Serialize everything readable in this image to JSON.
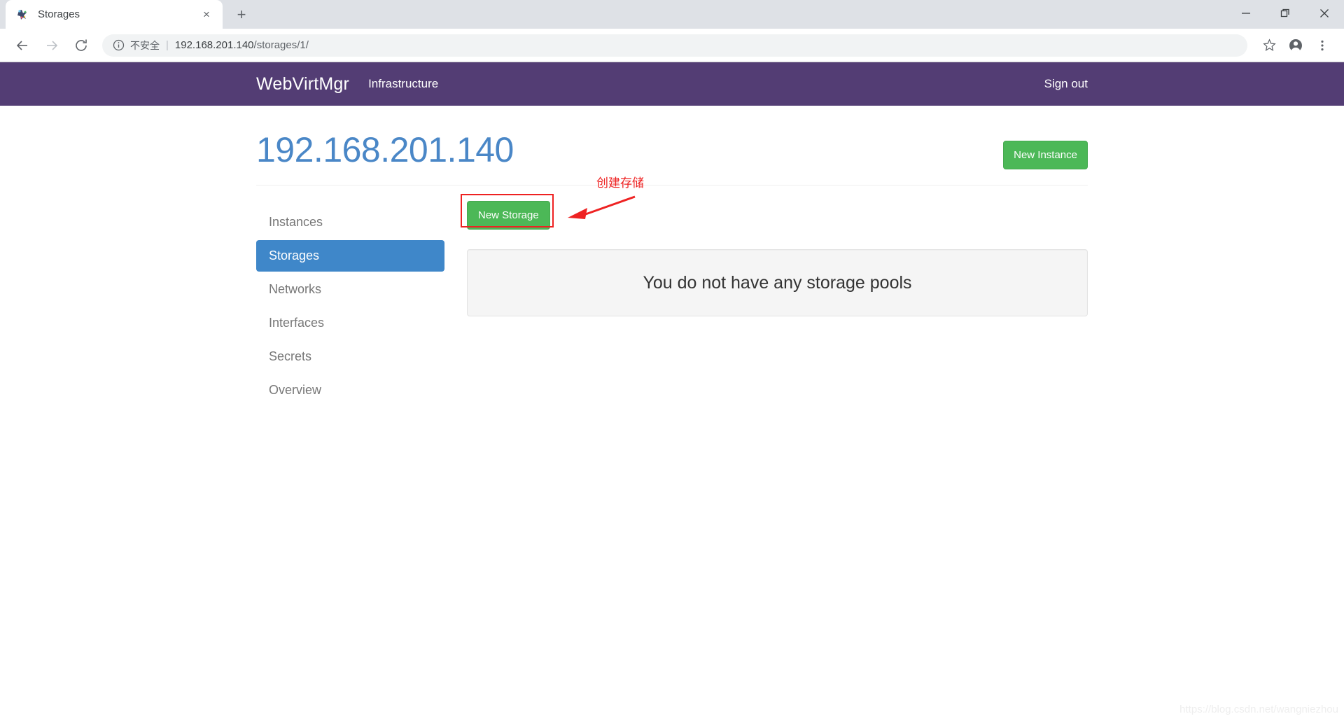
{
  "browser": {
    "tab": {
      "title": "Storages",
      "favicon": "webvirtmgr-favicon",
      "close_label": "×"
    },
    "new_tab_label": "+",
    "window_controls": {
      "minimize": "minimize-icon",
      "maximize": "restore-icon",
      "close": "close-icon"
    },
    "toolbar": {
      "back": "back-arrow-icon",
      "forward": "forward-arrow-icon",
      "reload": "reload-icon",
      "info_icon": "info-circle-icon",
      "security_text": "不安全",
      "separator": "|",
      "url_host": "192.168.201.140",
      "url_path": "/storages/1/",
      "bookmark": "star-icon",
      "profile": "account-avatar-icon",
      "menu": "three-dots-menu-icon"
    }
  },
  "navbar": {
    "brand": "WebVirtMgr",
    "links": [
      {
        "label": "Infrastructure"
      }
    ],
    "sign_out": "Sign out",
    "background": "#533D74"
  },
  "page": {
    "title": "192.168.201.140",
    "title_color": "#4a87c7",
    "new_instance_button": "New Instance",
    "new_storage_button": "New Storage",
    "button_color": "#4cb857"
  },
  "sidebar": {
    "items": [
      {
        "label": "Instances",
        "active": false
      },
      {
        "label": "Storages",
        "active": true
      },
      {
        "label": "Networks",
        "active": false
      },
      {
        "label": "Interfaces",
        "active": false
      },
      {
        "label": "Secrets",
        "active": false
      },
      {
        "label": "Overview",
        "active": false
      }
    ],
    "active_color": "#3f87c9"
  },
  "main": {
    "empty_state_text": "You do not have any storage pools"
  },
  "annotation": {
    "text": "创建存储",
    "color": "#ee2222"
  },
  "watermark": {
    "text": "https://blog.csdn.net/wangniezhou"
  }
}
